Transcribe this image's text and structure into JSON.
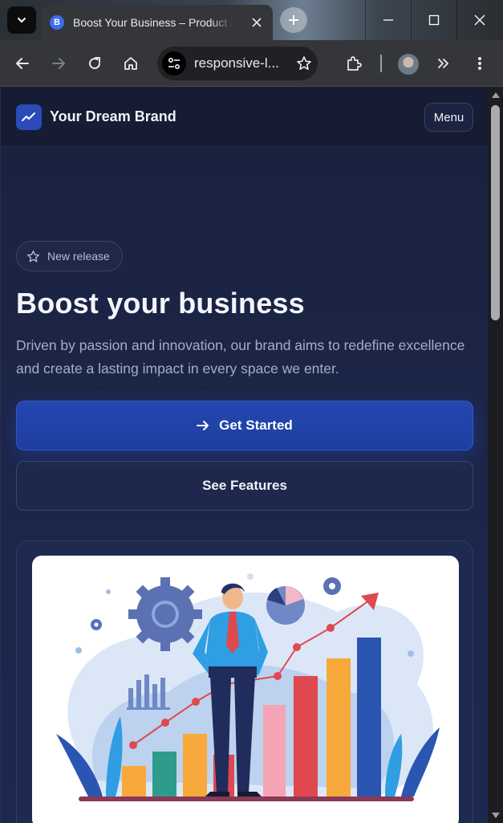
{
  "browser": {
    "tab_title": "Boost Your Business – Product Launch",
    "tab_favicon_letter": "B",
    "url": "responsive-l...",
    "icons": [
      "tab-search-icon",
      "close-icon",
      "plus-icon",
      "minimize-icon",
      "maximize-icon",
      "close-window-icon",
      "back-icon",
      "forward-icon",
      "reload-icon",
      "home-icon",
      "site-info-icon",
      "star-icon",
      "extensions-icon",
      "avatar",
      "chevron-double-right-icon",
      "kebab-menu-icon"
    ]
  },
  "site": {
    "brand_name": "Your Dream Brand",
    "menu_label": "Menu",
    "release_label": "New release",
    "title": "Boost your business",
    "subtitle": "Driven by passion and innovation, our brand aims to redefine excellence and create a lasting impact in every space we enter.",
    "primary_cta": "Get Started",
    "secondary_cta": "See Features",
    "colors": {
      "background": "#1a2240",
      "accent": "#2447b0",
      "text": "#f3f5fa",
      "muted": "#a6aec4"
    }
  }
}
